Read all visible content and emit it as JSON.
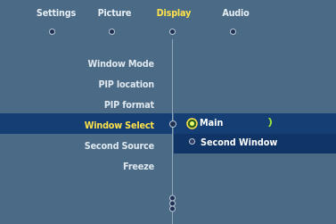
{
  "tabs": [
    {
      "label": "Settings"
    },
    {
      "label": "Picture"
    },
    {
      "label": "Display"
    },
    {
      "label": "Audio"
    }
  ],
  "menu": {
    "items": [
      {
        "label": "Window Mode"
      },
      {
        "label": "PIP location"
      },
      {
        "label": "PIP format"
      },
      {
        "label": "Window Select"
      },
      {
        "label": "Second Source"
      },
      {
        "label": "Freeze"
      }
    ]
  },
  "submenu": {
    "options": [
      {
        "label": "Main"
      },
      {
        "label": "Second Window"
      }
    ]
  },
  "colors": {
    "background": "#4a6a86",
    "highlight": "#153f74",
    "active_text": "#ffe24a",
    "text": "#dfe8ef"
  },
  "icons": {
    "radio_selected": "radio-selected-icon",
    "radio_unselected": "radio-unselected-icon",
    "arrow": "chevron-right-icon",
    "scroll": "scroll-down-icon"
  }
}
